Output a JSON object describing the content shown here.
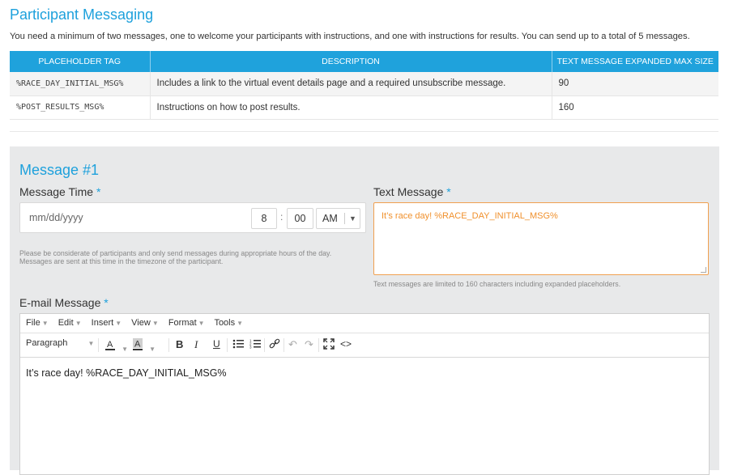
{
  "page": {
    "title": "Participant Messaging",
    "intro": "You need a minimum of two messages, one to welcome your participants with instructions, and one with instructions for results. You can send up to a total of 5 messages."
  },
  "placeholders": {
    "headers": [
      "PLACEHOLDER TAG",
      "DESCRIPTION",
      "TEXT MESSAGE EXPANDED MAX SIZE"
    ],
    "rows": [
      {
        "tag": "%RACE_DAY_INITIAL_MSG%",
        "description": "Includes a link to the virtual event details page and a required unsubscribe message.",
        "max": "90"
      },
      {
        "tag": "%POST_RESULTS_MSG%",
        "description": "Instructions on how to post results.",
        "max": "160"
      }
    ]
  },
  "message": {
    "heading": "Message #1",
    "time_label": "Message Time",
    "required_mark": "*",
    "date_placeholder": "mm/dd/yyyy",
    "hour": "8",
    "colon": ":",
    "minute": "00",
    "ampm": "AM",
    "considerate_note": "Please be considerate of participants and only send messages during appropriate hours of the day. Messages are sent at this time in the timezone of the participant.",
    "text_label": "Text Message",
    "text_value": "It’s race day! %RACE_DAY_INITIAL_MSG%",
    "text_note": "Text messages are limited to 160 characters including expanded placeholders.",
    "email_label": "E-mail Message",
    "email_content": "It’s race day! %RACE_DAY_INITIAL_MSG%"
  },
  "editor": {
    "menus": [
      "File",
      "Edit",
      "Insert",
      "View",
      "Format",
      "Tools"
    ],
    "block_format": "Paragraph",
    "colors": {
      "accent": "#1ea1dc",
      "header": "#1fa2dc",
      "focus": "#f0a050"
    }
  }
}
